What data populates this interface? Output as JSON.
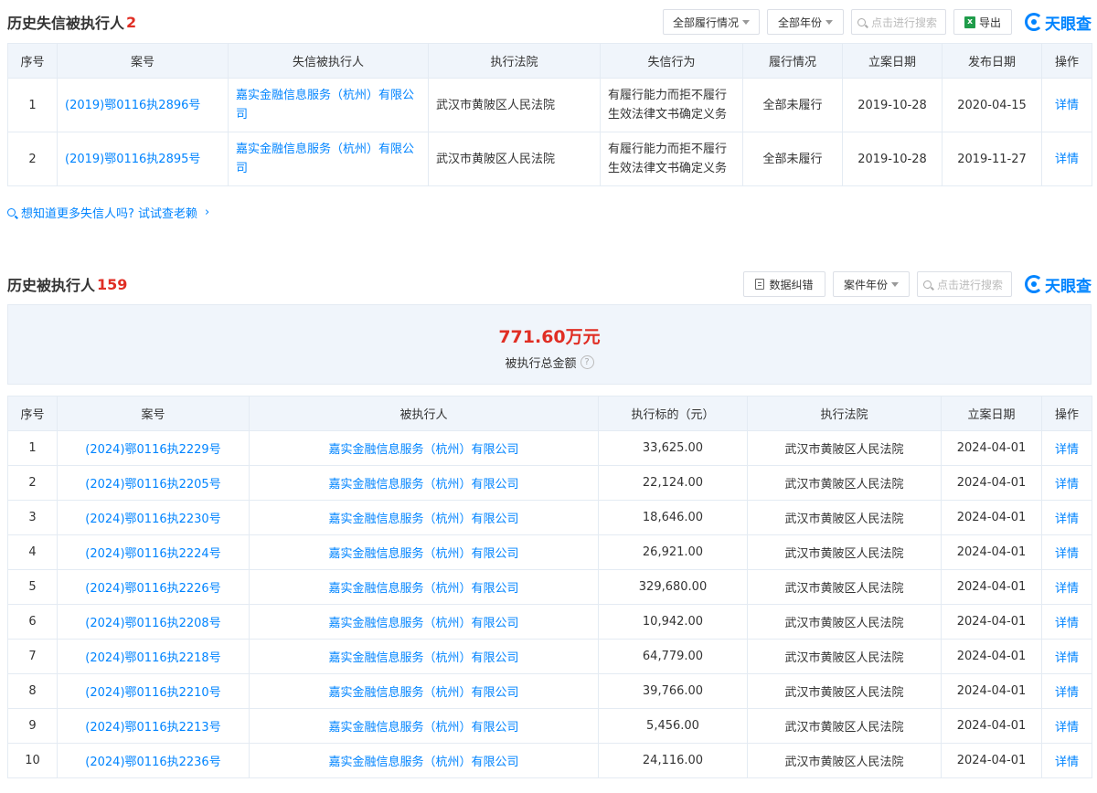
{
  "s1": {
    "title": "历史失信被执行人",
    "count": "2",
    "filter_perf": "全部履行情况",
    "filter_year": "全部年份",
    "search_placeholder": "点击进行搜索",
    "export_label": "导出",
    "logo_text": "天眼查",
    "headers": [
      "序号",
      "案号",
      "失信被执行人",
      "执行法院",
      "失信行为",
      "履行情况",
      "立案日期",
      "发布日期",
      "操作"
    ],
    "rows": [
      {
        "no": "1",
        "case": "(2019)鄂0116执2896号",
        "person": "嘉实金融信息服务（杭州）有限公司",
        "court": "武汉市黄陂区人民法院",
        "behavior": "有履行能力而拒不履行生效法律文书确定义务",
        "status": "全部未履行",
        "filed": "2019-10-28",
        "published": "2020-04-15",
        "action": "详情"
      },
      {
        "no": "2",
        "case": "(2019)鄂0116执2895号",
        "person": "嘉实金融信息服务（杭州）有限公司",
        "court": "武汉市黄陂区人民法院",
        "behavior": "有履行能力而拒不履行生效法律文书确定义务",
        "status": "全部未履行",
        "filed": "2019-10-28",
        "published": "2019-11-27",
        "action": "详情"
      }
    ]
  },
  "more_link": "想知道更多失信人吗? 试试查老赖",
  "s2": {
    "title": "历史被执行人",
    "count": "159",
    "correct_label": "数据纠错",
    "filter_year": "案件年份",
    "search_placeholder": "点击进行搜索",
    "logo_text": "天眼查",
    "total_amount": "771.60万元",
    "total_label": "被执行总金额",
    "help_glyph": "?",
    "headers": [
      "序号",
      "案号",
      "被执行人",
      "执行标的（元）",
      "执行法院",
      "立案日期",
      "操作"
    ],
    "rows": [
      {
        "no": "1",
        "case": "(2024)鄂0116执2229号",
        "person": "嘉实金融信息服务（杭州）有限公司",
        "amount": "33,625.00",
        "court": "武汉市黄陂区人民法院",
        "filed": "2024-04-01",
        "action": "详情"
      },
      {
        "no": "2",
        "case": "(2024)鄂0116执2205号",
        "person": "嘉实金融信息服务（杭州）有限公司",
        "amount": "22,124.00",
        "court": "武汉市黄陂区人民法院",
        "filed": "2024-04-01",
        "action": "详情"
      },
      {
        "no": "3",
        "case": "(2024)鄂0116执2230号",
        "person": "嘉实金融信息服务（杭州）有限公司",
        "amount": "18,646.00",
        "court": "武汉市黄陂区人民法院",
        "filed": "2024-04-01",
        "action": "详情"
      },
      {
        "no": "4",
        "case": "(2024)鄂0116执2224号",
        "person": "嘉实金融信息服务（杭州）有限公司",
        "amount": "26,921.00",
        "court": "武汉市黄陂区人民法院",
        "filed": "2024-04-01",
        "action": "详情"
      },
      {
        "no": "5",
        "case": "(2024)鄂0116执2226号",
        "person": "嘉实金融信息服务（杭州）有限公司",
        "amount": "329,680.00",
        "court": "武汉市黄陂区人民法院",
        "filed": "2024-04-01",
        "action": "详情"
      },
      {
        "no": "6",
        "case": "(2024)鄂0116执2208号",
        "person": "嘉实金融信息服务（杭州）有限公司",
        "amount": "10,942.00",
        "court": "武汉市黄陂区人民法院",
        "filed": "2024-04-01",
        "action": "详情"
      },
      {
        "no": "7",
        "case": "(2024)鄂0116执2218号",
        "person": "嘉实金融信息服务（杭州）有限公司",
        "amount": "64,779.00",
        "court": "武汉市黄陂区人民法院",
        "filed": "2024-04-01",
        "action": "详情"
      },
      {
        "no": "8",
        "case": "(2024)鄂0116执2210号",
        "person": "嘉实金融信息服务（杭州）有限公司",
        "amount": "39,766.00",
        "court": "武汉市黄陂区人民法院",
        "filed": "2024-04-01",
        "action": "详情"
      },
      {
        "no": "9",
        "case": "(2024)鄂0116执2213号",
        "person": "嘉实金融信息服务（杭州）有限公司",
        "amount": "5,456.00",
        "court": "武汉市黄陂区人民法院",
        "filed": "2024-04-01",
        "action": "详情"
      },
      {
        "no": "10",
        "case": "(2024)鄂0116执2236号",
        "person": "嘉实金融信息服务（杭州）有限公司",
        "amount": "24,116.00",
        "court": "武汉市黄陂区人民法院",
        "filed": "2024-04-01",
        "action": "详情"
      }
    ]
  },
  "colors": {
    "accent": "#0084ff",
    "alert": "#e02e24",
    "header_bg": "#f0f5fb"
  }
}
